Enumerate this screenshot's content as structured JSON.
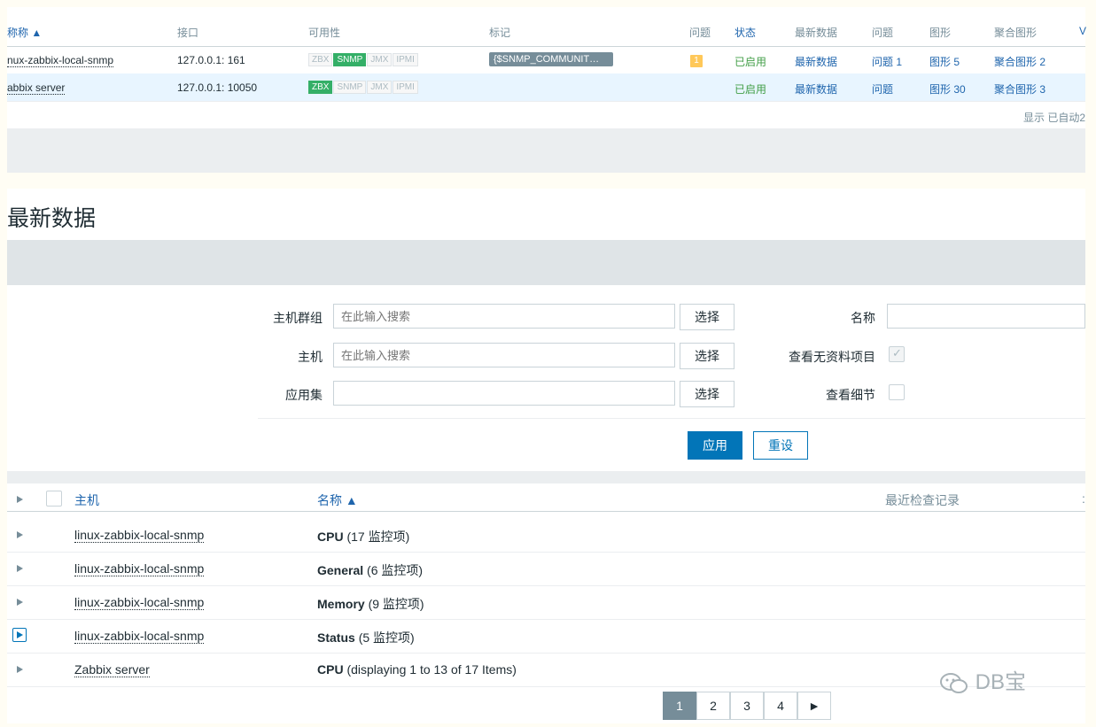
{
  "hosts_table": {
    "headers": {
      "name": "称称 ▲",
      "interface": "接口",
      "availability": "可用性",
      "tags": "标记",
      "problems": "问题",
      "status": "状态",
      "latest_data": "最新数据",
      "problems2": "问题",
      "graphs": "图形",
      "screens": "聚合图形",
      "more": "V"
    },
    "rows": [
      {
        "name": "nux-zabbix-local-snmp",
        "interface": "127.0.0.1: 161",
        "badges": [
          "ZBX",
          "SNMP",
          "JMX",
          "IPMI"
        ],
        "tag": "{$SNMP_COMMUNIT…",
        "problem_count": "1",
        "status": "已启用",
        "latest_data": "最新数据",
        "problems": "问题 1",
        "graphs": "图形 5",
        "screens": "聚合图形 2"
      },
      {
        "name": "abbix server",
        "interface": "127.0.0.1: 10050",
        "badges": [
          "ZBX",
          "SNMP",
          "JMX",
          "IPMI"
        ],
        "tag": "",
        "problem_count": "",
        "status": "已启用",
        "latest_data": "最新数据",
        "problems": "问题",
        "graphs": "图形 30",
        "screens": "聚合图形 3"
      }
    ],
    "footer": "显示 已自动2"
  },
  "latest": {
    "title": "最新数据",
    "filter": {
      "host_group_label": "主机群组",
      "host_group_placeholder": "在此输入搜索",
      "host_label": "主机",
      "host_placeholder": "在此输入搜索",
      "application_label": "应用集",
      "select_label": "选择",
      "name_label": "名称",
      "show_no_data_label": "查看无资料项目",
      "show_details_label": "查看细节",
      "apply": "应用",
      "reset": "重设"
    },
    "columns": {
      "host": "主机",
      "name": "名称 ▲",
      "last_check": "最近检查记录",
      "more": ":"
    },
    "rows": [
      {
        "host": "linux-zabbix-local-snmp",
        "app": "CPU",
        "detail": "(17 监控项)"
      },
      {
        "host": "linux-zabbix-local-snmp",
        "app": "General",
        "detail": "(6 监控项)"
      },
      {
        "host": "linux-zabbix-local-snmp",
        "app": "Memory",
        "detail": "(9 监控项)"
      },
      {
        "host": "linux-zabbix-local-snmp",
        "app": "Status",
        "detail": "(5 监控项)"
      },
      {
        "host": "Zabbix server",
        "app": "CPU",
        "detail": "(displaying 1 to 13 of 17 Items)"
      }
    ],
    "pager": [
      "1",
      "2",
      "3",
      "4",
      "►"
    ]
  },
  "watermark": "DB宝"
}
